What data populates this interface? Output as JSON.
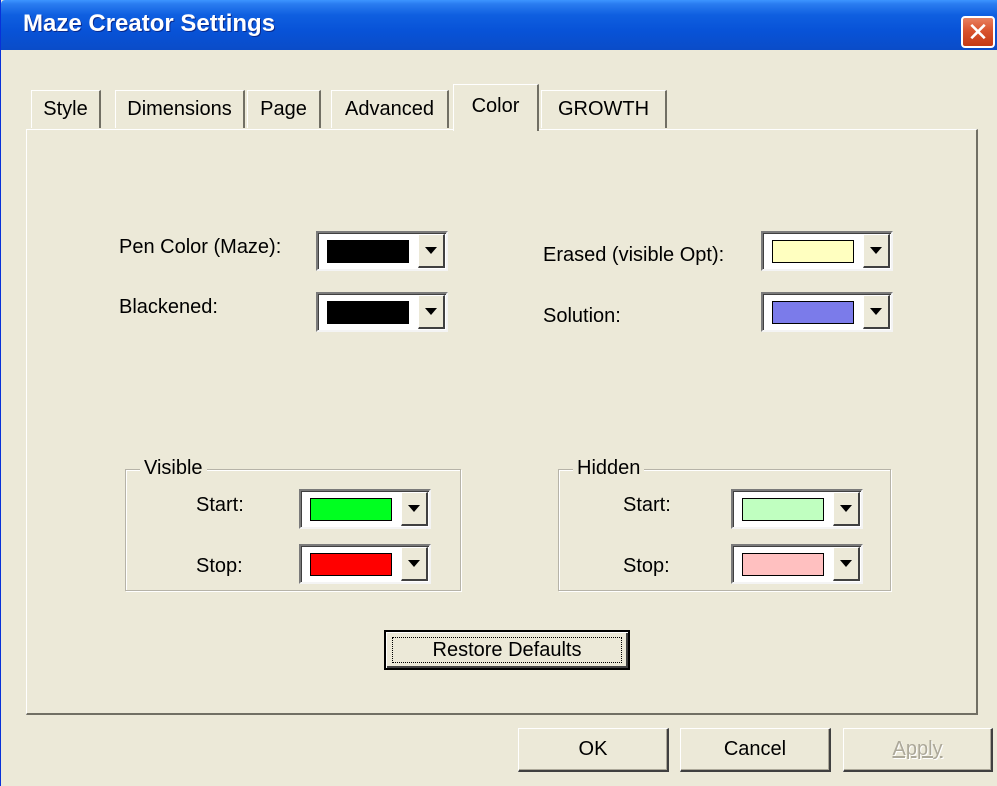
{
  "window": {
    "title": "Maze Creator Settings",
    "close_label": "✕"
  },
  "tabs": [
    {
      "label": "Style"
    },
    {
      "label": "Dimensions"
    },
    {
      "label": "Page"
    },
    {
      "label": "Advanced"
    },
    {
      "label": "Color",
      "active": true
    },
    {
      "label": "GROWTH"
    }
  ],
  "colors": {
    "pen_color": {
      "label": "Pen Color (Maze):",
      "value": "#000000"
    },
    "blackened": {
      "label": "Blackened:",
      "value": "#000000"
    },
    "erased": {
      "label": "Erased (visible Opt):",
      "value": "#ffffc0"
    },
    "solution": {
      "label": "Solution:",
      "value": "#7b7bea"
    }
  },
  "visible": {
    "title": "Visible",
    "start": {
      "label": "Start:",
      "value": "#00ff20"
    },
    "stop": {
      "label": "Stop:",
      "value": "#ff0000"
    }
  },
  "hidden": {
    "title": "Hidden",
    "start": {
      "label": "Start:",
      "value": "#c0ffc0"
    },
    "stop": {
      "label": "Stop:",
      "value": "#ffc0c0"
    }
  },
  "buttons": {
    "restore_defaults": "Restore Defaults",
    "ok": "OK",
    "cancel": "Cancel",
    "apply": "Apply"
  },
  "theme": {
    "titlebar": "#0853d8",
    "face": "#ece9d8",
    "close": "#d9532e"
  }
}
